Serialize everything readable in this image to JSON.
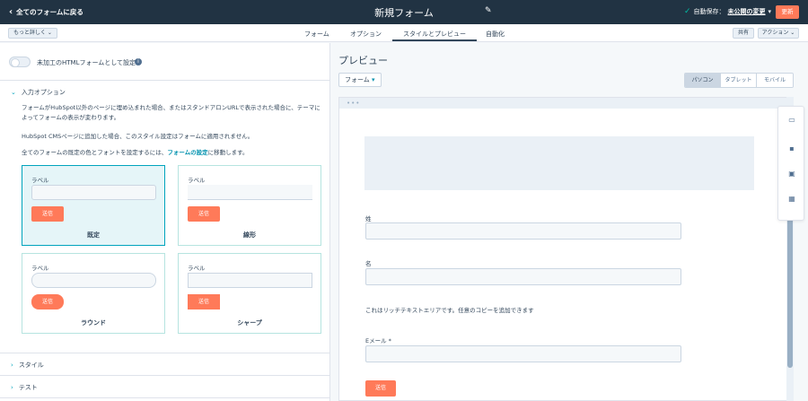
{
  "topbar": {
    "back_label": "全てのフォームに戻る",
    "title": "新規フォーム",
    "autosave_label": "自動保存：",
    "autosave_link": "未公開の変更",
    "update_label": "更新"
  },
  "navbar": {
    "more_label": "もっと詳しく ⌄",
    "tabs": [
      {
        "label": "フォーム"
      },
      {
        "label": "オプション"
      },
      {
        "label": "スタイルとプレビュー"
      },
      {
        "label": "自動化"
      }
    ],
    "active_tab": "スタイルとプレビュー",
    "share_label": "共有",
    "action_label": "アクション ⌄"
  },
  "left": {
    "html_toggle_label": "未加工のHTMLフォームとして設定",
    "input_options_heading": "入力オプション",
    "para1": "フォームがHubSpot以外のページに埋め込まれた場合、またはスタンドアロンURLで表示された場合に、テーマによってフォームの表示が変わります。",
    "para2": "HubSpot CMSページに追加した場合、このスタイル設定はフォームに適用されません。",
    "para3_before": "全てのフォームの既定の色とフォントを設定するには、",
    "para3_link": "フォームの設定",
    "para3_after": "に移動します。",
    "cards": [
      {
        "label": "ラベル",
        "submit": "送信",
        "name": "既定"
      },
      {
        "label": "ラベル",
        "submit": "送信",
        "name": "線形"
      },
      {
        "label": "ラベル",
        "submit": "送信",
        "name": "ラウンド"
      },
      {
        "label": "ラベル",
        "submit": "送信",
        "name": "シャープ"
      }
    ],
    "selected_card": "既定",
    "style_heading": "スタイル",
    "test_heading": "テスト"
  },
  "preview": {
    "title": "プレビュー",
    "form_dropdown": "フォーム",
    "devices": [
      {
        "label": "パソコン"
      },
      {
        "label": "タブレット"
      },
      {
        "label": "モバイル"
      }
    ],
    "active_device": "パソコン",
    "fields": [
      {
        "label": "姓"
      },
      {
        "label": "名"
      }
    ],
    "rich_text": "これはリッチテキストエリアです。任意のコピーを追加できます",
    "email_label": "Eメール *",
    "submit_label": "送信"
  },
  "colors": {
    "topbar": "#213343",
    "accent": "#ff7a59",
    "teal": "#00a4bd"
  }
}
